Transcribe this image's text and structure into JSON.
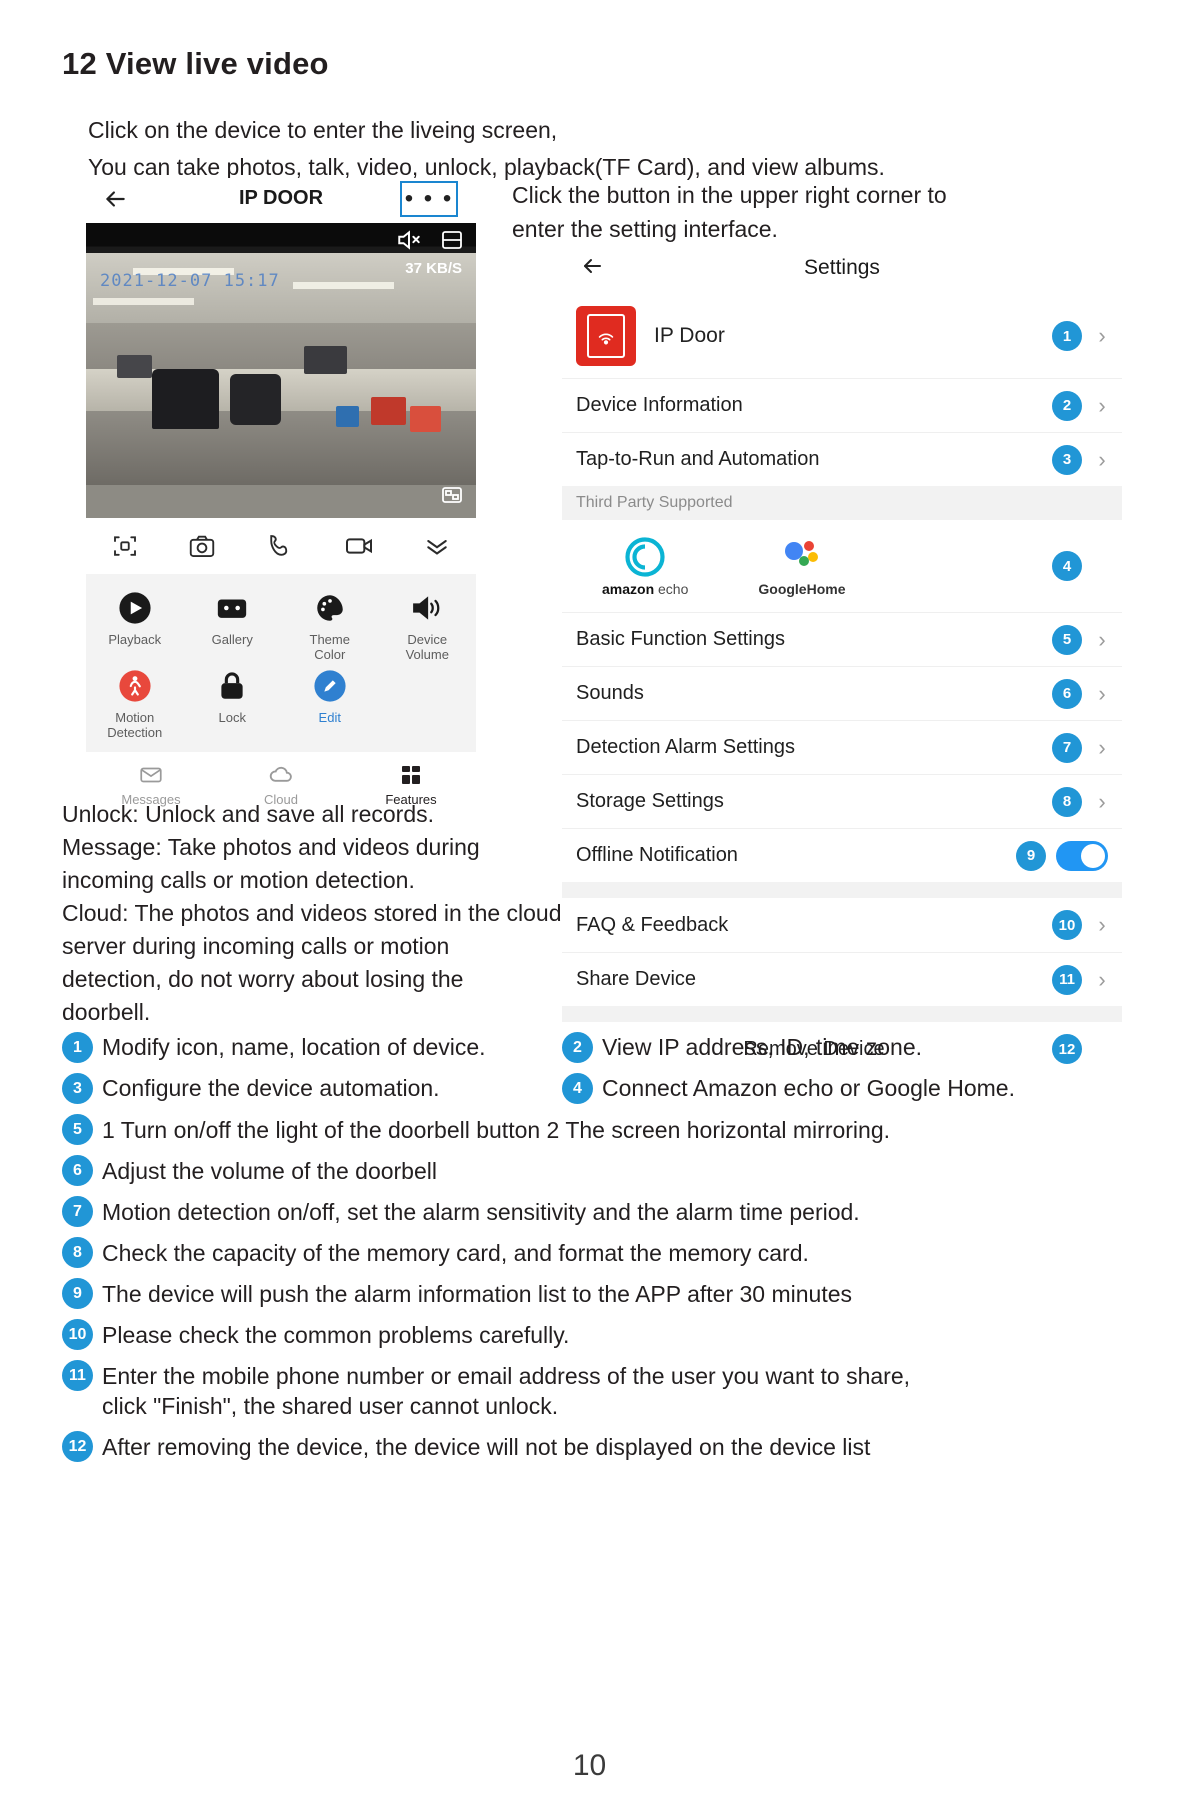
{
  "heading": "12 View live video",
  "intro": "Click on the device to enter the liveing screen,\nYou can take photos, talk, video, unlock, playback(TF Card), and view albums.",
  "phone": {
    "back_icon": "back-arrow-icon",
    "title": "IP DOOR",
    "more_label": "• • •",
    "video": {
      "timestamp": "2021-12-07 15:17",
      "bitrate": "37 KB/S",
      "mute_icon": "speaker-muted-icon",
      "layout_icon": "split-screen-icon",
      "fullscreen_icon": "fullscreen-icon"
    },
    "controls": [
      {
        "name": "snapshot-frame-icon"
      },
      {
        "name": "camera-icon"
      },
      {
        "name": "call-icon"
      },
      {
        "name": "video-record-icon"
      },
      {
        "name": "collapse-chevrons-icon"
      }
    ],
    "grid": [
      {
        "icon": "play-icon",
        "label": "Playback"
      },
      {
        "icon": "gallery-icon",
        "label": "Gallery"
      },
      {
        "icon": "palette-icon",
        "label": "Theme\nColor"
      },
      {
        "icon": "volume-icon",
        "label": "Device\nVolume"
      },
      {
        "icon": "motion-person-icon",
        "label": "Motion\nDetection"
      },
      {
        "icon": "lock-icon",
        "label": "Lock"
      },
      {
        "icon": "pencil-icon",
        "label": "Edit"
      }
    ],
    "tabs": [
      {
        "icon": "mail-icon",
        "label": "Messages",
        "active": false
      },
      {
        "icon": "cloud-icon",
        "label": "Cloud",
        "active": false
      },
      {
        "icon": "features-grid-icon",
        "label": "Features",
        "active": true
      }
    ]
  },
  "right_note": "Click the button in the upper right corner to enter the setting interface.",
  "settings": {
    "back_icon": "back-arrow-icon",
    "title": "Settings",
    "device_name": "IP Door",
    "device_icon": "doorbell-icon",
    "third_party_header": "Third Party Supported",
    "rows": [
      {
        "label": "IP Door",
        "num": "1",
        "chevron": true
      },
      {
        "label": "Device Information",
        "num": "2",
        "chevron": true
      },
      {
        "label": "Tap-to-Run and Automation",
        "num": "3",
        "chevron": true
      },
      {
        "label": "",
        "num": "4",
        "chevron": false
      },
      {
        "label": "Basic Function Settings",
        "num": "5",
        "chevron": true
      },
      {
        "label": "Sounds",
        "num": "6",
        "chevron": true
      },
      {
        "label": "Detection Alarm Settings",
        "num": "7",
        "chevron": true
      },
      {
        "label": "Storage Settings",
        "num": "8",
        "chevron": true
      },
      {
        "label": "Offline Notification",
        "num": "9",
        "chevron": false,
        "toggle": true
      },
      {
        "label": "FAQ & Feedback",
        "num": "10",
        "chevron": true
      },
      {
        "label": "Share Device",
        "num": "11",
        "chevron": true
      },
      {
        "label": "Remove Device",
        "num": "12",
        "chevron": false,
        "center": true
      }
    ],
    "brands": [
      {
        "icon": "amazon-alexa-icon",
        "text_main": "amazon",
        "text_sub": "echo"
      },
      {
        "icon": "google-home-icon",
        "text_main": "Google",
        "text_sub": "Home"
      }
    ]
  },
  "description": "Unlock: Unlock and save all records.\nMessage: Take photos and videos during\n            incoming calls or motion detection.\nCloud: The photos and videos stored in the cloud\n        server during incoming calls or motion\n        detection, do not worry about losing the\n        doorbell.",
  "legend": [
    {
      "num": "1",
      "text": "Modify icon, name, location of device."
    },
    {
      "num": "2",
      "text": "View IP address, ID, time zone."
    },
    {
      "num": "3",
      "text": "Configure the device automation."
    },
    {
      "num": "4",
      "text": "Connect Amazon echo or Google Home."
    },
    {
      "num": "5",
      "text": "1  Turn on/off the light of the doorbell button  2  The screen horizontal mirroring."
    },
    {
      "num": "6",
      "text": "Adjust the volume of the doorbell"
    },
    {
      "num": "7",
      "text": "Motion detection on/off, set the alarm sensitivity and the alarm time period."
    },
    {
      "num": "8",
      "text": "Check the capacity of the memory card, and format the memory card."
    },
    {
      "num": "9",
      "text": "The device will push the alarm information list to the APP after 30 minutes"
    },
    {
      "num": "10",
      "text": "Please check the common problems carefully."
    },
    {
      "num": "11",
      "text": "Enter the mobile phone number or email address of the user you want to share,\nclick \"Finish\", the shared user cannot unlock."
    },
    {
      "num": "12",
      "text": "After removing the device, the device will not be displayed on the device list"
    }
  ],
  "page_number": "10",
  "colors": {
    "accent": "#2196d6",
    "device_red": "#e02b20",
    "toggle_on": "#2196f3",
    "edit_blue": "#2f80d0"
  }
}
